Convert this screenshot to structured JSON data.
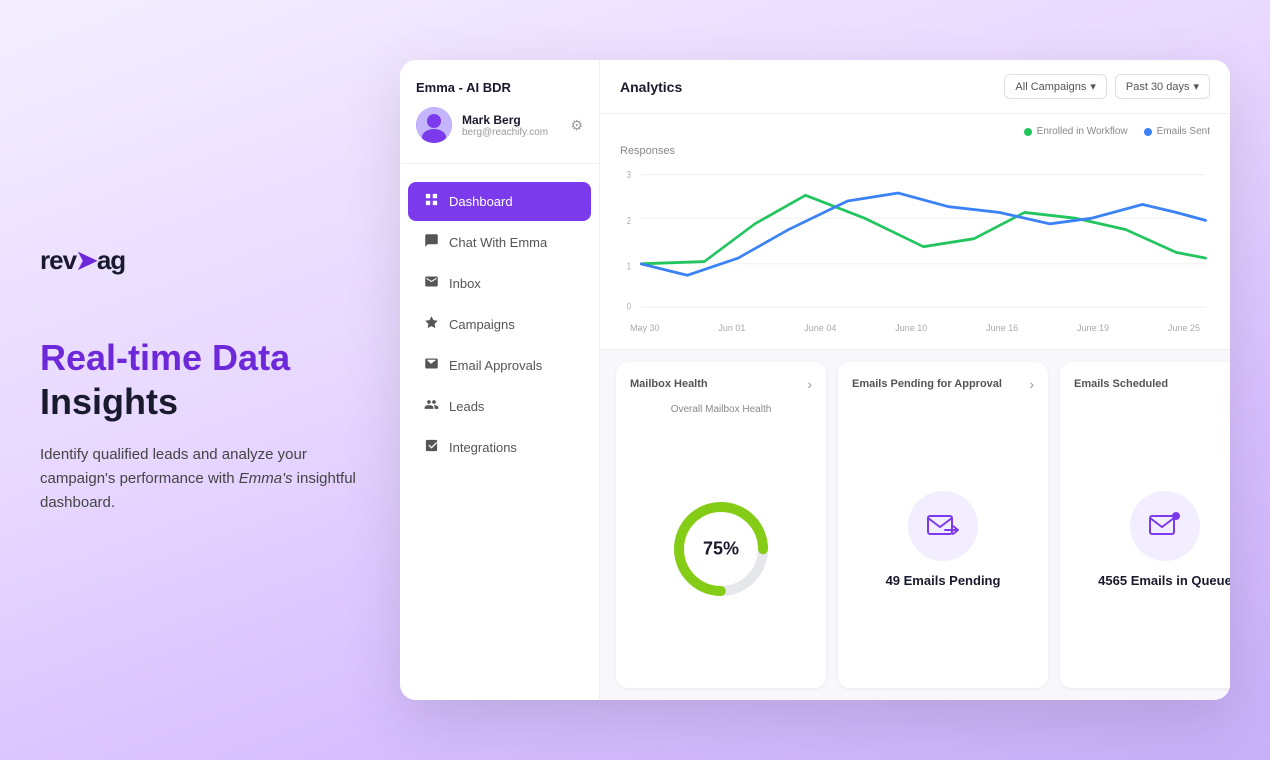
{
  "logo": {
    "text_before": "rev",
    "arrow": "➤",
    "text_after": "ag"
  },
  "hero": {
    "headline_purple": "Real-time Data",
    "headline_black": "Insights",
    "subtext": "Identify qualified leads and analyze your campaign's performance with ",
    "subtext_italic": "Emma's",
    "subtext_end": " insightful dashboard."
  },
  "sidebar": {
    "title": "Emma - AI BDR",
    "user": {
      "name": "Mark Berg",
      "email": "berg@reachify.com"
    },
    "nav_items": [
      {
        "id": "dashboard",
        "label": "Dashboard",
        "icon": "📊",
        "active": true
      },
      {
        "id": "chat",
        "label": "Chat With Emma",
        "icon": "💬",
        "active": false
      },
      {
        "id": "inbox",
        "label": "Inbox",
        "icon": "📧",
        "active": false
      },
      {
        "id": "campaigns",
        "label": "Campaigns",
        "icon": "🚀",
        "active": false
      },
      {
        "id": "email-approvals",
        "label": "Email Approvals",
        "icon": "📨",
        "active": false
      },
      {
        "id": "leads",
        "label": "Leads",
        "icon": "👥",
        "active": false
      },
      {
        "id": "integrations",
        "label": "Integrations",
        "icon": "🔗",
        "active": false
      }
    ]
  },
  "analytics": {
    "title": "Analytics",
    "filter_campaigns": "All Campaigns",
    "filter_period": "Past 30 days",
    "legend": [
      {
        "label": "Enrolled in Workflow",
        "color": "#22c55e"
      },
      {
        "label": "Emails Sent",
        "color": "#3b82f6"
      }
    ],
    "chart_label": "Responses",
    "x_labels": [
      "May 30",
      "Jun 01",
      "June 04",
      "June 10",
      "June 16",
      "June 19",
      "June 25"
    ],
    "y_labels": [
      "0",
      "1",
      "2",
      "3"
    ]
  },
  "cards": {
    "mailbox": {
      "title": "Mailbox Health",
      "subtitle": "Overall Mailbox Health",
      "value": "75%",
      "percentage": 75,
      "color_fill": "#84cc16",
      "color_track": "#e5e7eb"
    },
    "pending": {
      "title": "Emails Pending for Approval",
      "stat": "49 Emails Pending"
    },
    "scheduled": {
      "title": "Emails Scheduled",
      "stat": "4565 Emails in Queue"
    }
  }
}
